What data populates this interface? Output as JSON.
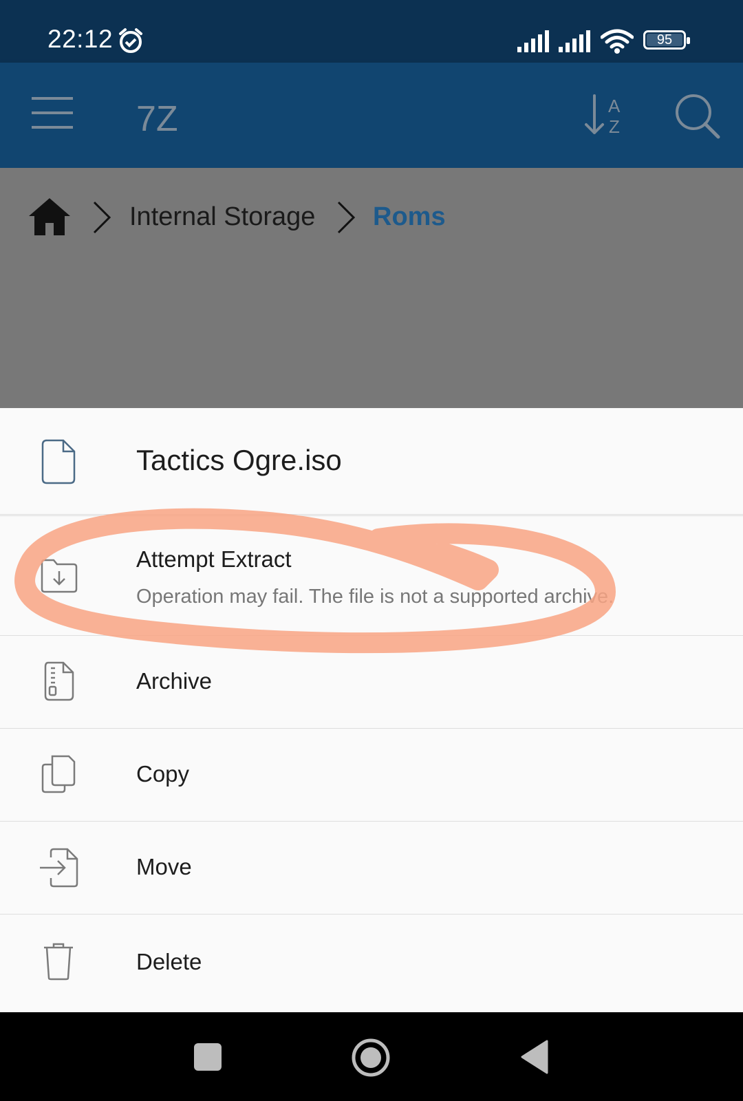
{
  "status_bar": {
    "time": "22:12",
    "battery": "95"
  },
  "app_bar": {
    "title": "7Z"
  },
  "breadcrumb": {
    "items": [
      "Internal Storage",
      "Roms"
    ]
  },
  "sheet": {
    "file_name": "Tactics Ogre.iso",
    "items": [
      {
        "label": "Attempt Extract",
        "subtitle": "Operation may fail. The file is not a supported archive."
      },
      {
        "label": "Archive"
      },
      {
        "label": "Copy"
      },
      {
        "label": "Move"
      },
      {
        "label": "Delete"
      }
    ]
  },
  "colors": {
    "status_bar": "#0c3152",
    "app_bar": "#114570",
    "accent": "#1d5a8c",
    "annotation": "#f8a383"
  }
}
